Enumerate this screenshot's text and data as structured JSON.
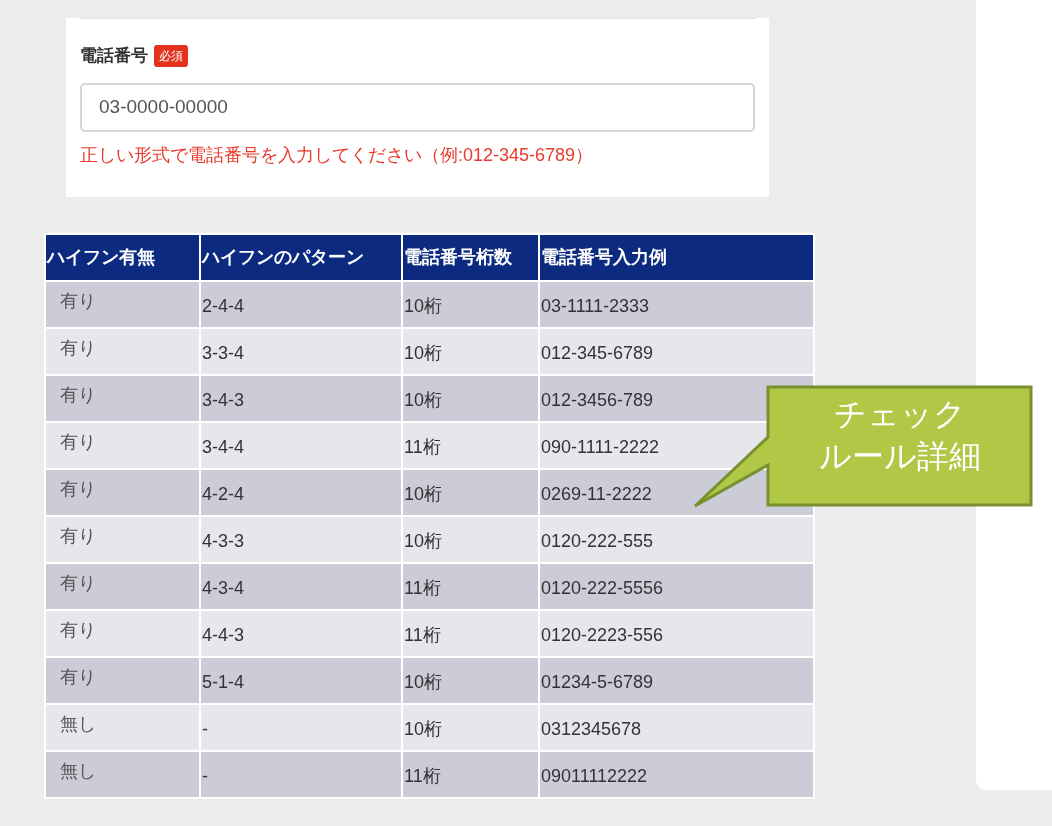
{
  "form": {
    "label": "電話番号",
    "badge": "必須",
    "value": "03-0000-00000",
    "error": "正しい形式で電話番号を入力してください（例:012-345-6789）"
  },
  "table": {
    "columns": [
      "ハイフン有無",
      "ハイフンのパターン",
      "電話番号桁数",
      "電話番号入力例"
    ],
    "rows": [
      [
        "有り",
        "2-4-4",
        "10桁",
        "03-1111-2333"
      ],
      [
        "有り",
        "3-3-4",
        "10桁",
        "012-345-6789"
      ],
      [
        "有り",
        "3-4-3",
        "10桁",
        "012-3456-789"
      ],
      [
        "有り",
        "3-4-4",
        "11桁",
        "090-1111-2222"
      ],
      [
        "有り",
        "4-2-4",
        "10桁",
        "0269-11-2222"
      ],
      [
        "有り",
        "4-3-3",
        "10桁",
        "0120-222-555"
      ],
      [
        "有り",
        "4-3-4",
        "11桁",
        "0120-222-5556"
      ],
      [
        "有り",
        "4-4-3",
        "11桁",
        "0120-2223-556"
      ],
      [
        "有り",
        "5-1-4",
        "10桁",
        "01234-5-6789"
      ],
      [
        "無し",
        "-",
        "10桁",
        "0312345678"
      ],
      [
        "無し",
        "-",
        "11桁",
        "09011112222"
      ]
    ]
  },
  "callout": {
    "lines": [
      "チェック",
      "ルール詳細"
    ]
  }
}
